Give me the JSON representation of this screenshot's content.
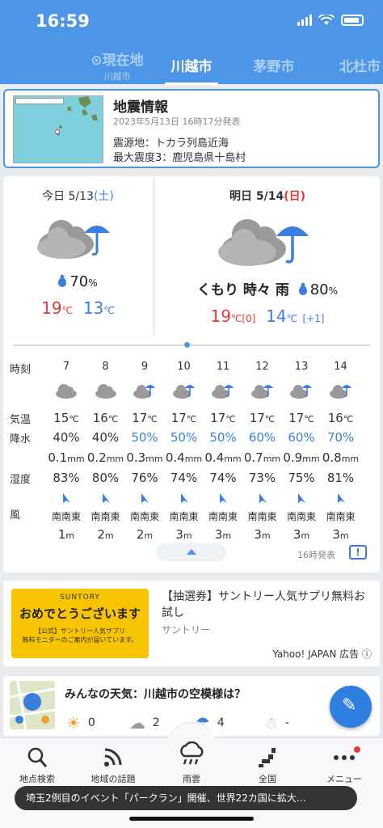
{
  "status_bar": {
    "time": "16:59"
  },
  "tabs": [
    {
      "label": "現在地",
      "sub": "川越市"
    },
    {
      "label": "川越市",
      "sub": ""
    },
    {
      "label": "茅野市",
      "sub": ""
    },
    {
      "label": "北杜市",
      "sub": ""
    }
  ],
  "quake": {
    "title": "地震情報",
    "date": "2023年5月13日 16時17分発表",
    "epicenter": "震源地：トカラ列島近海",
    "intensity": "最大震度3：鹿児島県十島村"
  },
  "today": {
    "label": "今日 5/13",
    "weekday": "(土)",
    "pop": "70",
    "pop_unit": "%",
    "high": "19",
    "low": "13",
    "unit": "℃"
  },
  "tomorrow": {
    "label": "明日 5/14",
    "weekday": "(日)",
    "weather": "くもり 時々 雨",
    "pop": "80",
    "pop_unit": "%",
    "high": "19",
    "high_diff": "[0]",
    "low": "14",
    "low_diff": "[+1]",
    "unit": "℃"
  },
  "hourly_labels": {
    "time": "時刻",
    "temp": "気温",
    "precip": "降水",
    "humidity": "湿度",
    "wind": "風"
  },
  "hourly": [
    {
      "hour": "7",
      "temp": "15",
      "pop": "40%",
      "mm": "0.1",
      "hum": "83%",
      "dir": "南南東",
      "speed": "1"
    },
    {
      "hour": "8",
      "temp": "16",
      "pop": "40%",
      "mm": "0.2",
      "hum": "80%",
      "dir": "南南東",
      "speed": "2"
    },
    {
      "hour": "9",
      "temp": "17",
      "pop": "50%",
      "mm": "0.3",
      "hum": "76%",
      "dir": "南南東",
      "speed": "2"
    },
    {
      "hour": "10",
      "temp": "17",
      "pop": "50%",
      "mm": "0.4",
      "hum": "74%",
      "dir": "南南東",
      "speed": "3"
    },
    {
      "hour": "11",
      "temp": "17",
      "pop": "50%",
      "mm": "0.4",
      "hum": "74%",
      "dir": "南南東",
      "speed": "3"
    },
    {
      "hour": "12",
      "temp": "17",
      "pop": "60%",
      "mm": "0.7",
      "hum": "73%",
      "dir": "南南東",
      "speed": "3"
    },
    {
      "hour": "13",
      "temp": "17",
      "pop": "60%",
      "mm": "0.9",
      "hum": "75%",
      "dir": "南南東",
      "speed": "3"
    },
    {
      "hour": "14",
      "temp": "16",
      "pop": "70%",
      "mm": "0.8",
      "hum": "81%",
      "dir": "南南東",
      "speed": "3"
    }
  ],
  "issued": "16時発表",
  "ad": {
    "brand": "SUNTORY",
    "image_headline": "おめでとうございます",
    "image_line1": "【公式】サントリー人気サプリ",
    "image_line2": "無料モニターのご案内が届いています。",
    "title": "【抽選券】サントリー人気サプリ無料お試し",
    "source": "サントリー",
    "tag": "Yahoo! JAPAN 広告"
  },
  "social": {
    "title": "みんなの天気：川越市の空模様は？",
    "sunny": "0",
    "cloudy": "2",
    "rainy": "4",
    "snowy": "-"
  },
  "nav": [
    {
      "label": "地点検索"
    },
    {
      "label": "地域の話題"
    },
    {
      "label": "雨雲"
    },
    {
      "label": "全国"
    },
    {
      "label": "メニュー"
    }
  ],
  "ticker": "埼玉2例目のイベント「パークラン」開催、世界22カ国に拡大…"
}
